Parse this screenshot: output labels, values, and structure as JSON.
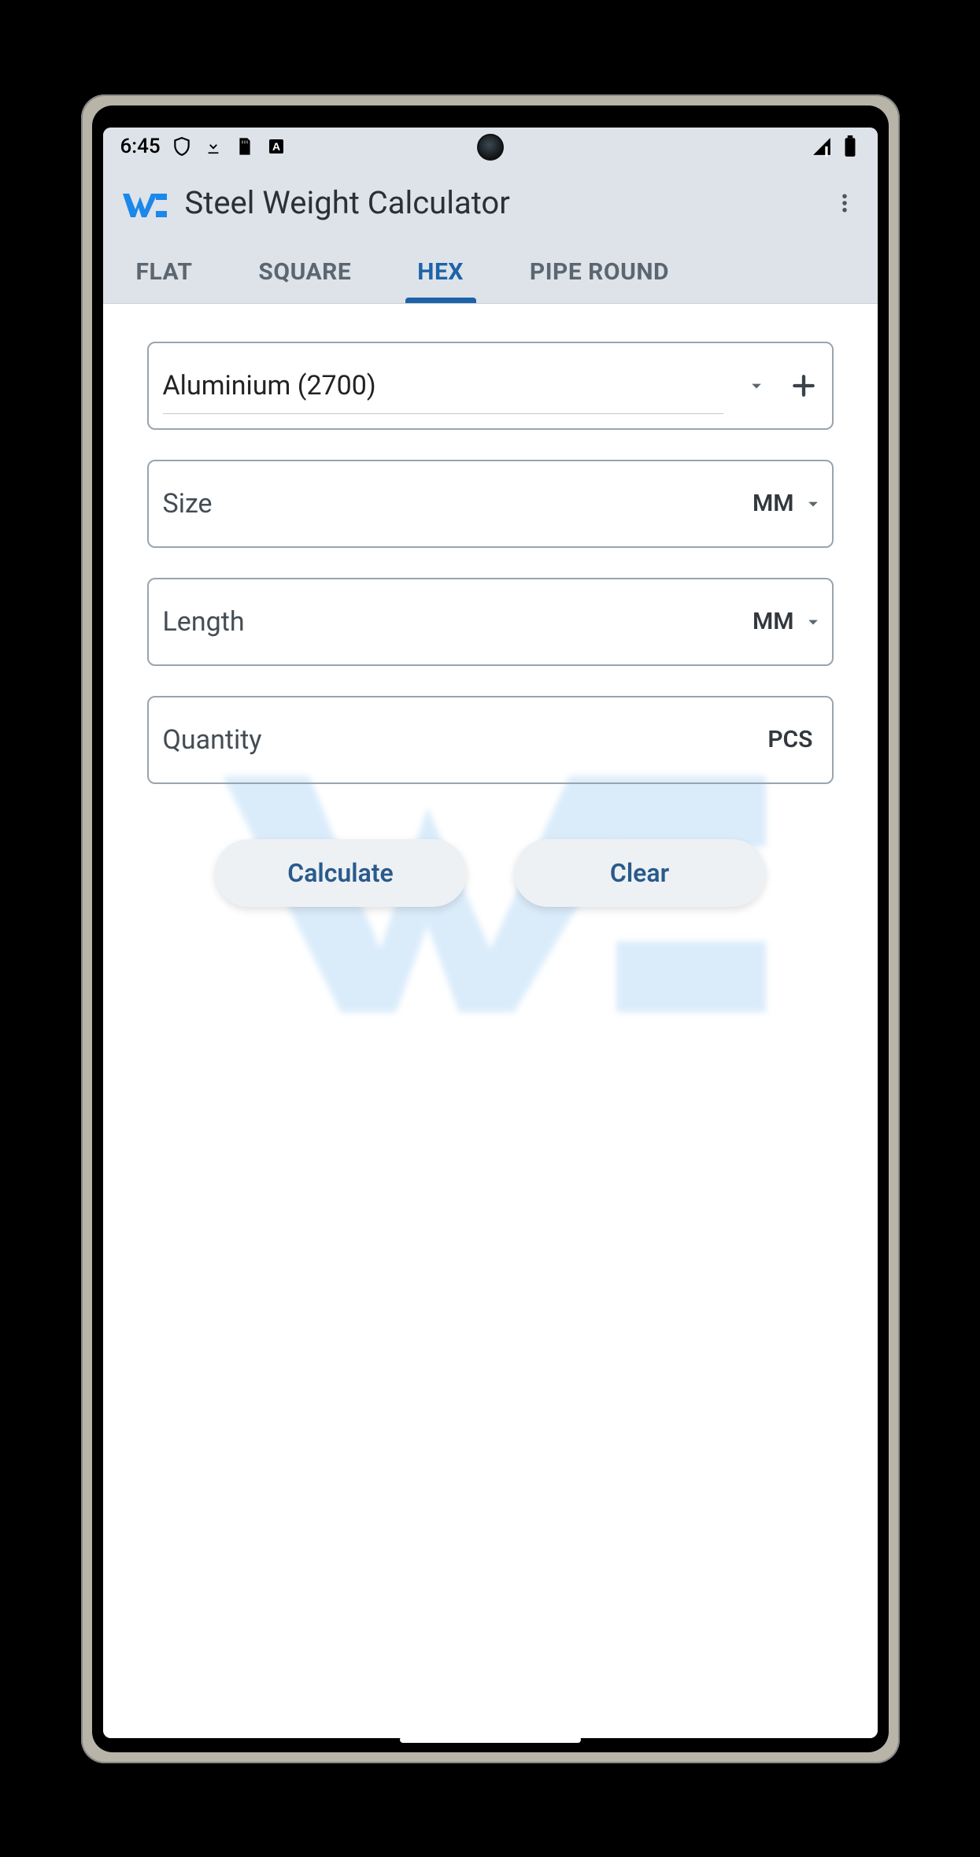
{
  "status": {
    "time": "6:45"
  },
  "header": {
    "title": "Steel Weight Calculator"
  },
  "tabs": {
    "items": [
      "FLAT",
      "SQUARE",
      "HEX",
      "PIPE ROUND"
    ],
    "active_index": 2
  },
  "form": {
    "material": {
      "value": "Aluminium (2700)"
    },
    "size": {
      "label": "Size",
      "unit": "MM"
    },
    "length": {
      "label": "Length",
      "unit": "MM"
    },
    "quantity": {
      "label": "Quantity",
      "unit": "PCS"
    }
  },
  "buttons": {
    "calculate": "Calculate",
    "clear": "Clear"
  }
}
